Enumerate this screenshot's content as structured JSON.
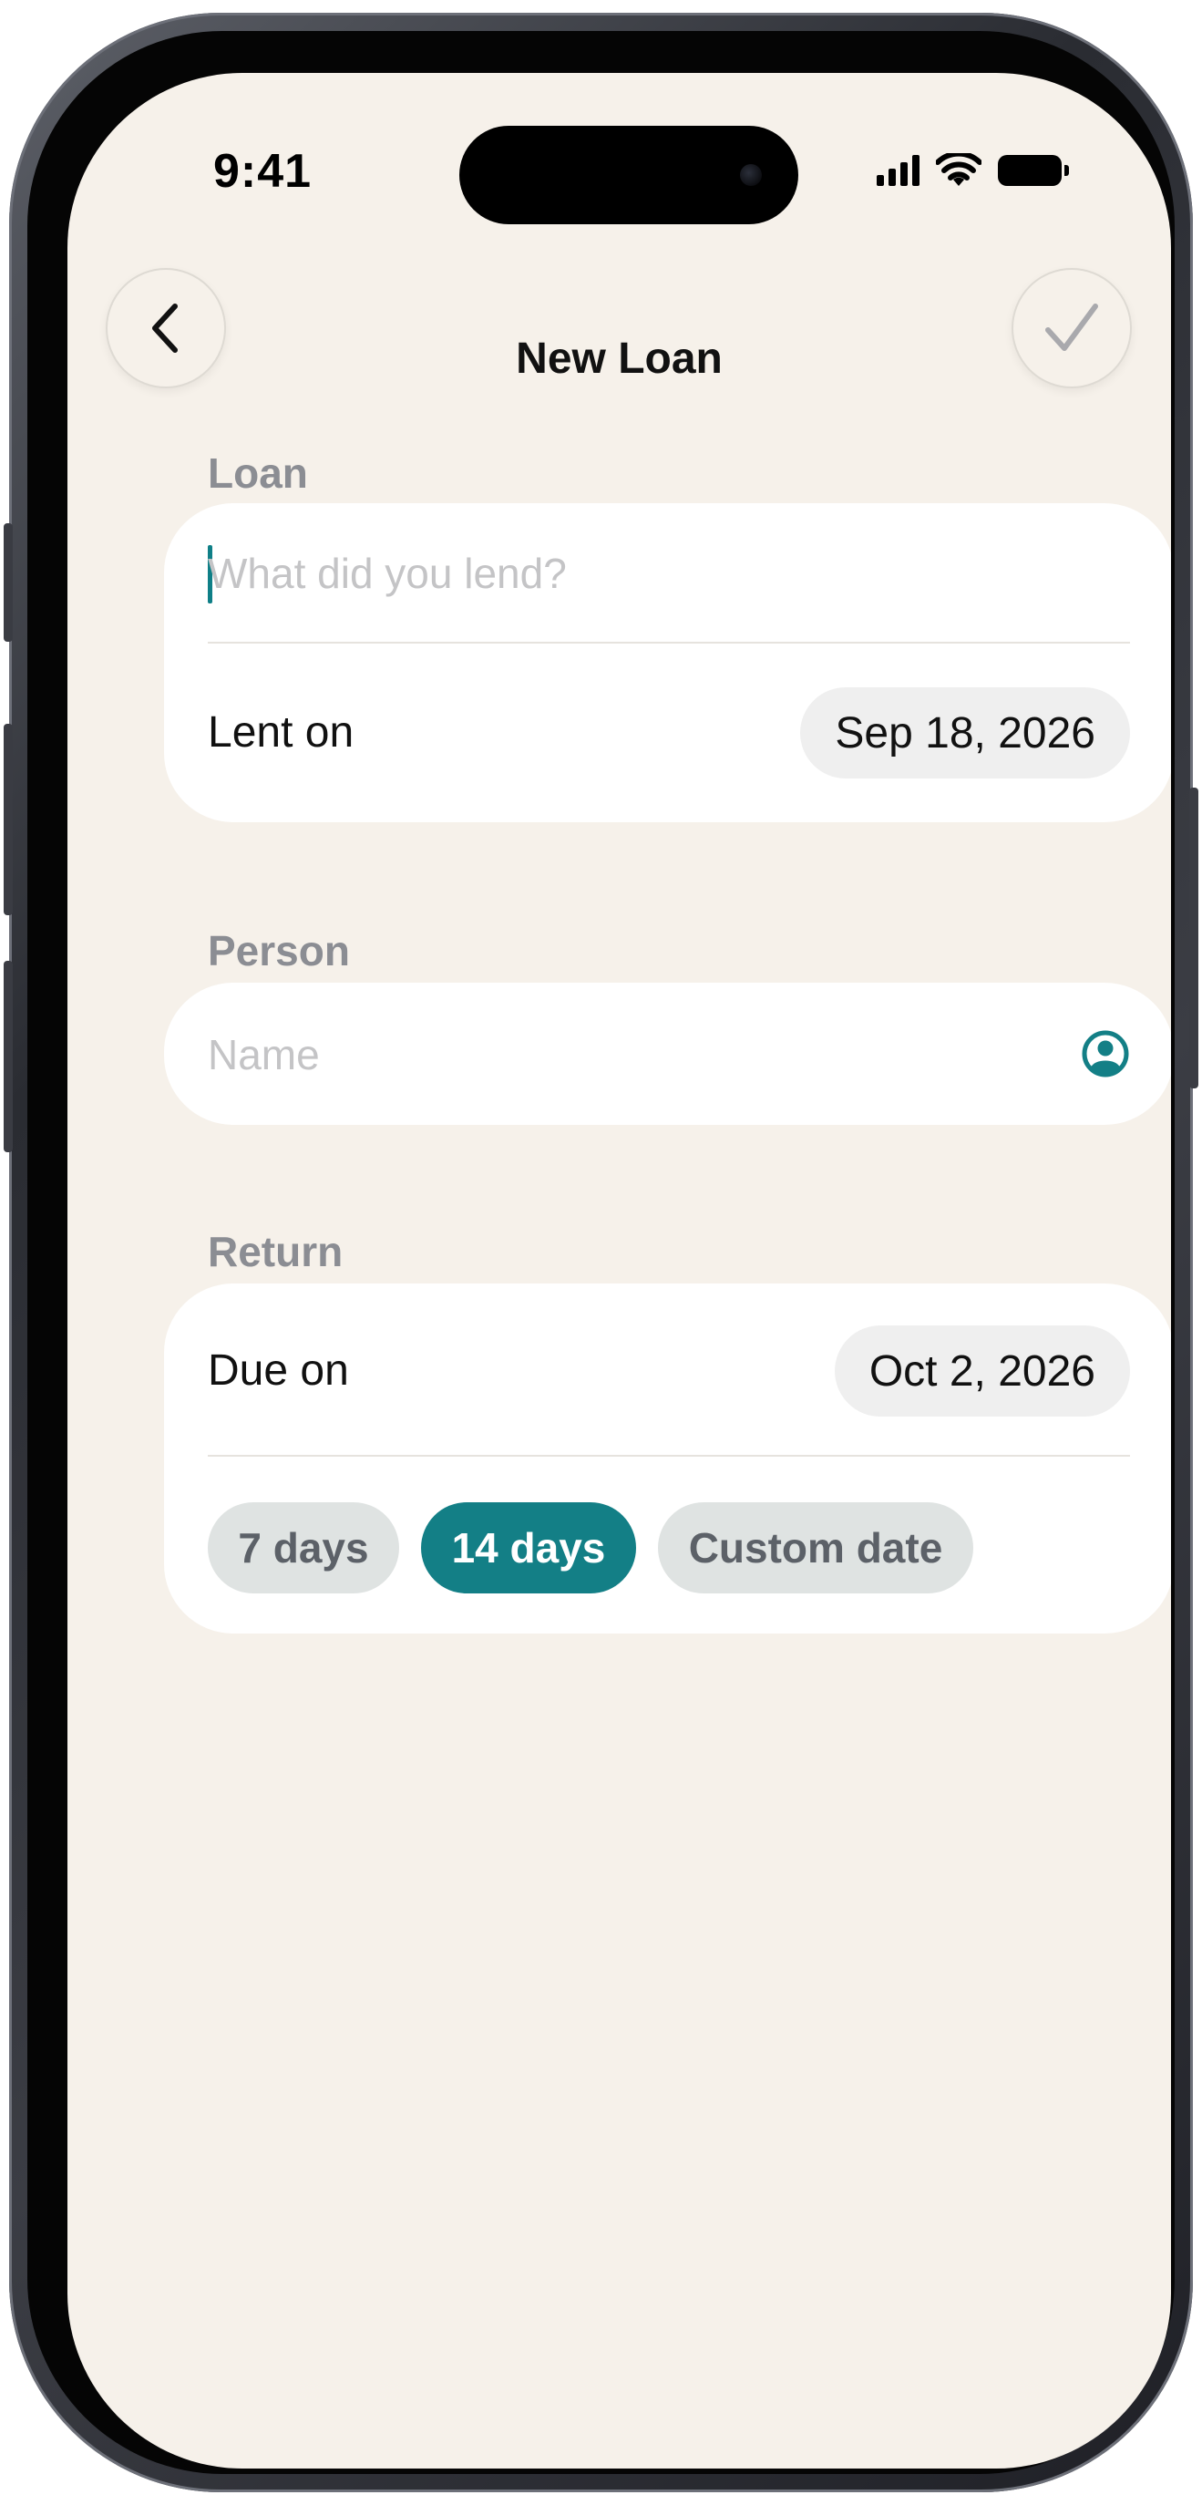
{
  "status_bar": {
    "time": "9:41"
  },
  "nav": {
    "title": "New Loan",
    "back_icon": "chevron-left-icon",
    "save_icon": "checkmark-icon"
  },
  "loan_section": {
    "label": "Loan",
    "item_placeholder": "What did you lend?",
    "item_value": "",
    "lent_on_label": "Lent on",
    "lent_on_date": "Sep 18, 2026"
  },
  "person_section": {
    "label": "Person",
    "name_placeholder": "Name",
    "name_value": "",
    "contact_icon": "person-circle-icon"
  },
  "return_section": {
    "label": "Return",
    "due_on_label": "Due on",
    "due_on_date": "Oct 2, 2026",
    "presets": [
      {
        "label": "7 days",
        "selected": false
      },
      {
        "label": "14 days",
        "selected": true
      },
      {
        "label": "Custom date",
        "selected": false
      }
    ]
  },
  "colors": {
    "background": "#f6f1ea",
    "accent": "#137f86",
    "card": "#ffffff",
    "section_label": "#8b8d93",
    "chip_inactive": "#dfe3e2"
  }
}
